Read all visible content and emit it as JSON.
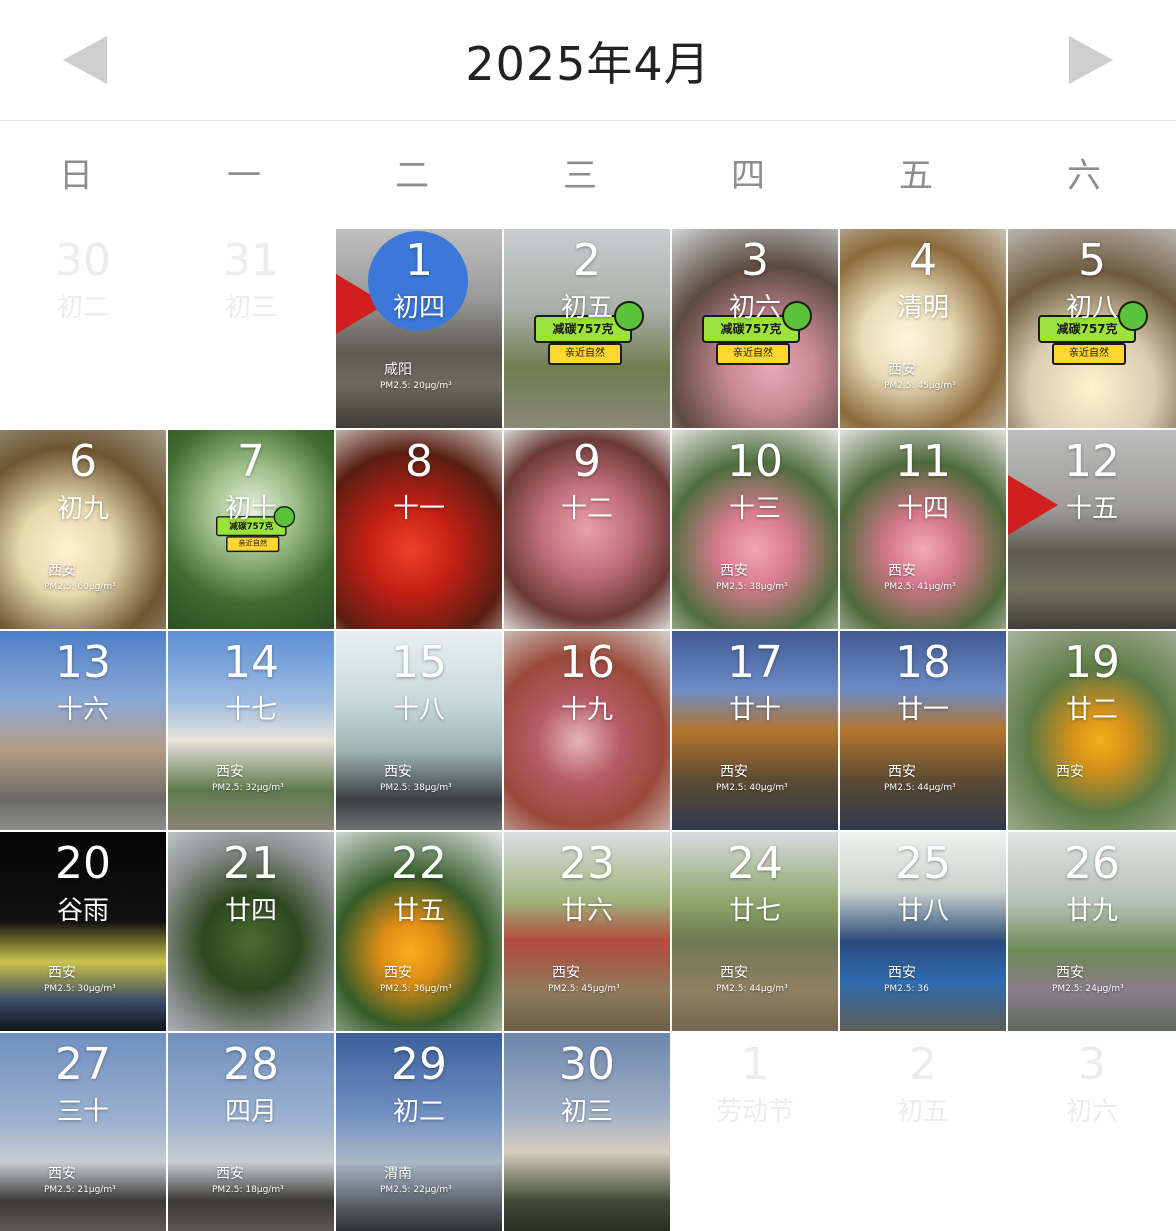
{
  "header": {
    "title": "2025年4月",
    "prev_label": "◀",
    "next_label": "▶"
  },
  "weekdays": [
    "日",
    "一",
    "二",
    "三",
    "四",
    "五",
    "六"
  ],
  "badge": {
    "label": "减碳757克",
    "sub": "亲近自然"
  },
  "colors": {
    "today": "#3b78d8",
    "empty_text": "#ececec"
  },
  "rows": [
    [
      {
        "day": "30",
        "lunar": "初二",
        "empty": true
      },
      {
        "day": "31",
        "lunar": "初三",
        "empty": true
      },
      {
        "day": "1",
        "lunar": "初四",
        "today": true,
        "city": "咸阳",
        "pm": "PM2.5: 20μg/m³",
        "bg": "linear-gradient(180deg,#bfbfbf 0%,#9a9a9a 35%,#5d5b52 62%,#6f6a5f 78%,#3f3c36 100%)",
        "redflag": true
      },
      {
        "day": "2",
        "lunar": "初五",
        "badge": true,
        "bg": "linear-gradient(180deg,#c9cdd0 0%,#a9b0a9 40%,#6f7d4f 70%,#8a8878 100%)"
      },
      {
        "day": "3",
        "lunar": "初六",
        "badge": true,
        "bg": "radial-gradient(circle at 60% 70%,#e7a9b8 0%,#c98a95 25%,#5b4a3f 60%,#cfd3d6 100%)"
      },
      {
        "day": "4",
        "lunar": "清明",
        "city": "西安",
        "pm": "PM2.5: 45μg/m³",
        "bg": "radial-gradient(circle at 40% 55%,#fff6dd 0%,#e8dcb8 30%,#8b6a3a 65%,#c9c3b3 100%)"
      },
      {
        "day": "5",
        "lunar": "初八",
        "badge": true,
        "bg": "radial-gradient(circle at 50% 80%,#fff2cf 0%,#d9ccb0 35%,#6f5a3d 65%,#b9b6b0 100%)"
      }
    ],
    [
      {
        "day": "6",
        "lunar": "初九",
        "city": "西安",
        "pm": "PM2.5: 60μg/m³",
        "bg": "radial-gradient(circle at 40% 60%,#fff1d0 0%,#e7d8ad 30%,#6d5532 65%,#a39a86 100%)"
      },
      {
        "day": "7",
        "lunar": "初十",
        "badge": true,
        "small": true,
        "bg": "radial-gradient(circle at 50% 40%,#e8f0e0 0%,#9fc08a 30%,#3f6b2f 65%,#2e4d23 100%)"
      },
      {
        "day": "8",
        "lunar": "十一",
        "bg": "radial-gradient(circle at 45% 60%,#f04028 0%,#c21f14 30%,#5a1e12 65%,#d7d3cf 100%)"
      },
      {
        "day": "9",
        "lunar": "十二",
        "bg": "radial-gradient(circle at 50% 50%,#e8a1a9 0%,#c16f7c 35%,#6b3a36 70%,#d9d6d4 100%)"
      },
      {
        "day": "10",
        "lunar": "十三",
        "city": "西安",
        "pm": "PM2.5: 38μg/m³",
        "bg": "radial-gradient(circle at 50% 60%,#f2a6b6 0%,#d97c90 25%,#4f6e3e 60%,#e5e4e1 100%)"
      },
      {
        "day": "11",
        "lunar": "十四",
        "city": "西安",
        "pm": "PM2.5: 41μg/m³",
        "bg": "radial-gradient(circle at 50% 60%,#f4aab8 0%,#d37788 25%,#4e6a3a 60%,#e2e1de 100%)"
      },
      {
        "day": "12",
        "lunar": "十五",
        "bg": "linear-gradient(180deg,#bdbdbd 0%,#9c9b98 40%,#5e5a50 62%,#75705f 80%,#403d37 100%)",
        "redflag": true
      }
    ],
    [
      {
        "day": "13",
        "lunar": "十六",
        "bg": "linear-gradient(180deg,#4f7fc8 0%,#8aa9d6 35%,#b59b84 60%,#6b6b66 85%,#8d8d8d 100%)"
      },
      {
        "day": "14",
        "lunar": "十七",
        "city": "西安",
        "pm": "PM2.5: 32μg/m³",
        "bg": "linear-gradient(180deg,#5d8fd4 0%,#9fbde3 35%,#e7e2da 55%,#5f7a4c 80%,#8a8378 100%)"
      },
      {
        "day": "15",
        "lunar": "十八",
        "city": "西安",
        "pm": "PM2.5: 38μg/m³",
        "bg": "linear-gradient(180deg,#e9eff1 0%,#c8d9dc 35%,#9fb4b4 60%,#3c3f40 85%,#6e7373 100%)"
      },
      {
        "day": "16",
        "lunar": "十九",
        "bg": "radial-gradient(circle at 45% 55%,#e6b5b8 0%,#b55b66 30%,#9a4a3a 60%,#d5d1cd 100%)"
      },
      {
        "day": "17",
        "lunar": "廿十",
        "city": "西安",
        "pm": "PM2.5: 40μg/m³",
        "bg": "linear-gradient(180deg,#3f5a93 0%,#6f8cc6 30%,#b3752f 50%,#5d4a33 75%,#2f3a4e 100%)"
      },
      {
        "day": "18",
        "lunar": "廿一",
        "city": "西安",
        "pm": "PM2.5: 44μg/m³",
        "bg": "linear-gradient(180deg,#405b94 0%,#6e8bc5 30%,#b4762f 50%,#5c4a33 75%,#2f394d 100%)"
      },
      {
        "day": "19",
        "lunar": "廿二",
        "city": "西安",
        "pm": "",
        "bg": "radial-gradient(circle at 55% 55%,#f3b21a 0%,#d6911a 20%,#5d7a45 50%,#a8b49e 100%)"
      }
    ],
    [
      {
        "day": "20",
        "lunar": "谷雨",
        "city": "西安",
        "pm": "PM2.5: 30μg/m³",
        "bg": "linear-gradient(180deg,#050505 0%,#111 45%,#c9c24a 65%,#3b4a66 85%,#0f1520 100%)"
      },
      {
        "day": "21",
        "lunar": "廿四",
        "bg": "radial-gradient(circle at 50% 55%,#4c6a2f 0%,#2e4720 35%,#8c8f8f 70%,#bcc2c5 100%)"
      },
      {
        "day": "22",
        "lunar": "廿五",
        "city": "西安",
        "pm": "PM2.5: 36μg/m³",
        "bg": "radial-gradient(circle at 45% 60%,#f7b01c 0%,#e08d15 20%,#355c28 50%,#e5e7ea 100%)"
      },
      {
        "day": "23",
        "lunar": "廿六",
        "city": "西安",
        "pm": "PM2.5: 45μg/m³",
        "bg": "linear-gradient(180deg,#d9dfe2 0%,#9fb27a 35%,#b24a3f 55%,#8f7a5b 80%,#6f5f48 100%)"
      },
      {
        "day": "24",
        "lunar": "廿七",
        "city": "西安",
        "pm": "PM2.5: 44μg/m³",
        "bg": "linear-gradient(180deg,#d8dde0 0%,#8ea66c 35%,#6e7a52 55%,#8f7f61 80%,#746650 100%)"
      },
      {
        "day": "25",
        "lunar": "廿八",
        "city": "西安",
        "pm": "PM2.5: 36",
        "bg": "linear-gradient(180deg,#f0f2ef 0%,#c7d1cc 30%,#2a4a7a 55%,#2f6bb0 75%,#5c5d54 100%)"
      },
      {
        "day": "26",
        "lunar": "廿九",
        "city": "西安",
        "pm": "PM2.5: 24μg/m³",
        "bg": "linear-gradient(180deg,#dfe3e3 0%,#b6c2b8 35%,#6f8a56 60%,#8a7c8a 80%,#5d6b59 100%)"
      }
    ],
    [
      {
        "day": "27",
        "lunar": "三十",
        "city": "西安",
        "pm": "PM2.5: 21μg/m³",
        "bg": "linear-gradient(180deg,#6f90c2 0%,#9cb2cf 45%,#c7cdd4 65%,#3c3a38 85%,#5d5a55 100%)"
      },
      {
        "day": "28",
        "lunar": "四月",
        "city": "西安",
        "pm": "PM2.5: 18μg/m³",
        "bg": "linear-gradient(180deg,#7190c0 0%,#9db3d0 45%,#c8cdd3 65%,#3b3936 85%,#5c5954 100%)"
      },
      {
        "day": "29",
        "lunar": "初二",
        "city": "渭南",
        "pm": "PM2.5: 22μg/m³",
        "bg": "linear-gradient(180deg,#3c5f9a 0%,#6f8fc2 40%,#a9b7c9 65%,#4e5358 90%,#2e3236 100%)"
      },
      {
        "day": "30",
        "lunar": "初三",
        "bg": "linear-gradient(180deg,#6c85ab 0%,#9fb0c6 40%,#d7cdbf 60%,#3e4a34 85%,#263025 100%)"
      },
      {
        "day": "1",
        "lunar": "劳动节",
        "empty": true
      },
      {
        "day": "2",
        "lunar": "初五",
        "empty": true
      },
      {
        "day": "3",
        "lunar": "初六",
        "empty": true
      }
    ]
  ]
}
